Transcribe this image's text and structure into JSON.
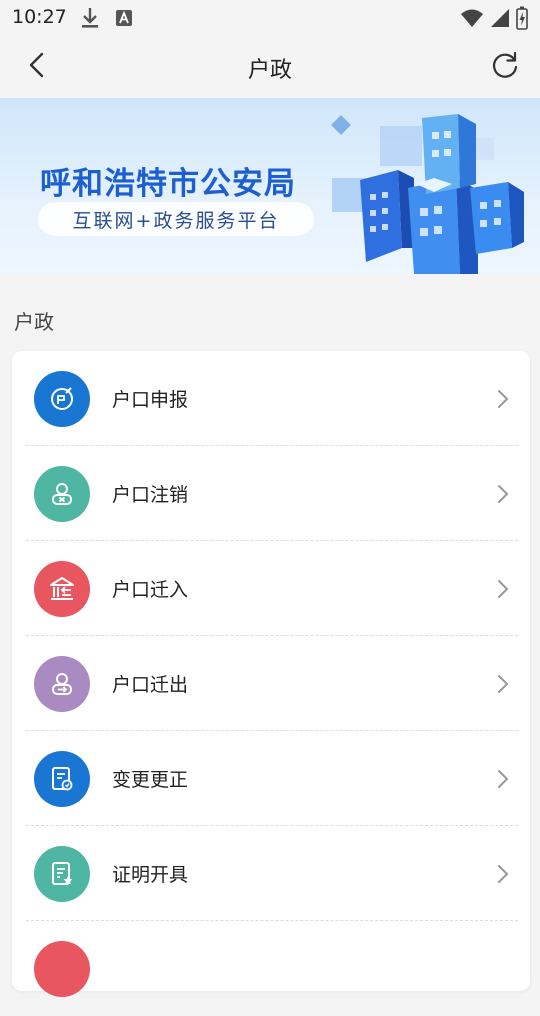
{
  "status_bar": {
    "time": "10:27"
  },
  "header": {
    "title": "户政"
  },
  "banner": {
    "title": "呼和浩特市公安局",
    "subtitle": "互联网+政务服务平台"
  },
  "section": {
    "title": "户政"
  },
  "colors": {
    "blue": "#1976d2",
    "teal": "#4fb6a3",
    "red": "#e8575f",
    "purple": "#a98bc1"
  },
  "items": [
    {
      "label": "户口申报",
      "icon": "hukou-declare-icon",
      "color": "#1976d2"
    },
    {
      "label": "户口注销",
      "icon": "hukou-cancel-icon",
      "color": "#4fb6a3"
    },
    {
      "label": "户口迁入",
      "icon": "hukou-move-in-icon",
      "color": "#e8575f"
    },
    {
      "label": "户口迁出",
      "icon": "hukou-move-out-icon",
      "color": "#a98bc1"
    },
    {
      "label": "变更更正",
      "icon": "change-correct-icon",
      "color": "#1976d2"
    },
    {
      "label": "证明开具",
      "icon": "certificate-issue-icon",
      "color": "#4fb6a3"
    },
    {
      "label": "",
      "icon": "partial-item-icon",
      "color": "#e8575f"
    }
  ]
}
